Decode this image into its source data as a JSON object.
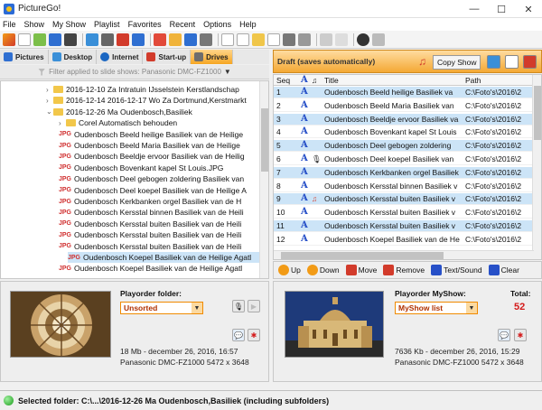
{
  "window": {
    "title": "PictureGo!",
    "min": "—",
    "max": "☐",
    "close": "✕"
  },
  "menu": [
    "File",
    "Show",
    "My Show",
    "Playlist",
    "Favorites",
    "Recent",
    "Options",
    "Help"
  ],
  "left_tabs": [
    {
      "label": "Pictures",
      "color": "#2f6fd1"
    },
    {
      "label": "Desktop",
      "color": "#3a8fd8"
    },
    {
      "label": "Internet",
      "color": "#1a66c2"
    },
    {
      "label": "Start-up",
      "color": "#d23b2b"
    },
    {
      "label": "Drives",
      "color": "#6d6d6d"
    }
  ],
  "filter_text": "Filter applied to slide shows: Panasonic DMC-FZ1000",
  "tree": [
    {
      "text": "2016-12-10 Za Intratuin IJsselstein Kerstlandschap",
      "kind": "folder",
      "indent": 1,
      "toggle": "›"
    },
    {
      "text": "2016-12-14 2016-12-17 Wo Za Dortmund,Kerstmarkt",
      "kind": "folder",
      "indent": 1,
      "toggle": "›"
    },
    {
      "text": "2016-12-26 Ma Oudenbosch,Basiliek",
      "kind": "folder",
      "indent": 1,
      "toggle": "⌄"
    },
    {
      "text": "Corel Automatisch behouden",
      "kind": "folder",
      "indent": 2,
      "toggle": "›"
    },
    {
      "text": "Oudenbosch Beeld heilige Basiliek van de Heilige",
      "kind": "jpg",
      "indent": 2
    },
    {
      "text": "Oudenbosch Beeld Maria Basiliek van de Heilige",
      "kind": "jpg",
      "indent": 2
    },
    {
      "text": "Oudenbosch Beeldje ervoor Basiliek van de Heilig",
      "kind": "jpg",
      "indent": 2
    },
    {
      "text": "Oudenbosch Bovenkant kapel St Louis.JPG",
      "kind": "jpg",
      "indent": 2
    },
    {
      "text": "Oudenbosch Deel gebogen zoldering Basiliek van",
      "kind": "jpg",
      "indent": 2
    },
    {
      "text": "Oudenbosch Deel koepel Basiliek van de Heilige A",
      "kind": "jpg",
      "indent": 2
    },
    {
      "text": "Oudenbosch Kerkbanken orgel Basiliek van de H",
      "kind": "jpg",
      "indent": 2
    },
    {
      "text": "Oudenbosch Kersstal binnen Basiliek van de Heili",
      "kind": "jpg",
      "indent": 2
    },
    {
      "text": "Oudenbosch Kersstal buiten Basiliek van de Heili",
      "kind": "jpg",
      "indent": 2
    },
    {
      "text": "Oudenbosch Kersstal buiten Basiliek van de Heili",
      "kind": "jpg",
      "indent": 2
    },
    {
      "text": "Oudenbosch Kersstal buiten Basiliek van de Heili",
      "kind": "jpg",
      "indent": 2
    },
    {
      "text": "Oudenbosch Koepel Basiliek van de Heilige Agatl",
      "kind": "jpg",
      "indent": 2,
      "selected": true
    },
    {
      "text": "Oudenbosch Koepel Basiliek van de Heilige Agatl",
      "kind": "jpg",
      "indent": 2
    }
  ],
  "left_bottom": {
    "playorder_label": "Playorder folder:",
    "playorder_value": "Unsorted",
    "size_date": "18 Mb -    december 26, 2016, 16:57",
    "camera": "Panasonic DMC-FZ1000   5472 x 3648"
  },
  "right": {
    "draft_title": "Draft (saves automatically)",
    "copy_button": "Copy Show",
    "columns": {
      "seq": "Seq",
      "title": "Title",
      "path": "Path"
    },
    "rows": [
      {
        "seq": "1",
        "title": "Oudenbosch Beeld heilige Basiliek va",
        "path": "C:\\Foto's\\2016\\2",
        "extra": ""
      },
      {
        "seq": "2",
        "title": "Oudenbosch Beeld Maria Basiliek van",
        "path": "C:\\Foto's\\2016\\2",
        "extra": ""
      },
      {
        "seq": "3",
        "title": "Oudenbosch Beeldje ervoor Basiliek va",
        "path": "C:\\Foto's\\2016\\2",
        "extra": ""
      },
      {
        "seq": "4",
        "title": "Oudenbosch Bovenkant kapel St Louis",
        "path": "C:\\Foto's\\2016\\2",
        "extra": ""
      },
      {
        "seq": "5",
        "title": "Oudenbosch Deel gebogen zoldering",
        "path": "C:\\Foto's\\2016\\2",
        "extra": ""
      },
      {
        "seq": "6",
        "title": "Oudenbosch Deel koepel Basiliek van",
        "path": "C:\\Foto's\\2016\\2",
        "extra": "mic"
      },
      {
        "seq": "7",
        "title": "Oudenbosch Kerkbanken orgel Basiliek",
        "path": "C:\\Foto's\\2016\\2",
        "extra": ""
      },
      {
        "seq": "8",
        "title": "Oudenbosch Kersstal binnen Basiliek v",
        "path": "C:\\Foto's\\2016\\2",
        "extra": ""
      },
      {
        "seq": "9",
        "title": "Oudenbosch Kersstal buiten Basiliek v",
        "path": "C:\\Foto's\\2016\\2",
        "extra": "music"
      },
      {
        "seq": "10",
        "title": "Oudenbosch Kersstal buiten Basiliek v",
        "path": "C:\\Foto's\\2016\\2",
        "extra": ""
      },
      {
        "seq": "11",
        "title": "Oudenbosch Kersstal buiten Basiliek v",
        "path": "C:\\Foto's\\2016\\2",
        "extra": ""
      },
      {
        "seq": "12",
        "title": "Oudenbosch Koepel Basiliek van de He",
        "path": "C:\\Foto's\\2016\\2",
        "extra": ""
      }
    ],
    "grid_buttons": [
      {
        "label": "Up",
        "color": "#f29b16"
      },
      {
        "label": "Down",
        "color": "#f29b16"
      },
      {
        "label": "Move",
        "color": "#d23b2b"
      },
      {
        "label": "Remove",
        "color": "#d23b2b"
      },
      {
        "label": "Text/Sound",
        "color": "#2750c8"
      },
      {
        "label": "Clear",
        "color": "#2750c8"
      }
    ],
    "playorder_label": "Playorder MyShow:",
    "playorder_value": "MyShow list",
    "total_label": "Total:",
    "total_value": "52",
    "size_date": "7636 Kb -    december 26, 2016, 15:29",
    "camera": "Panasonic DMC-FZ1000   5472 x 3648"
  },
  "status": "Selected folder: C:\\...\\2016-12-26 Ma Oudenbosch,Basiliek (including subfolders)",
  "colors": {
    "accent_orange": "#f4a834",
    "selection": "#cce4f7",
    "icon_blue": "#2750c8",
    "total_red": "#d41a1a"
  }
}
